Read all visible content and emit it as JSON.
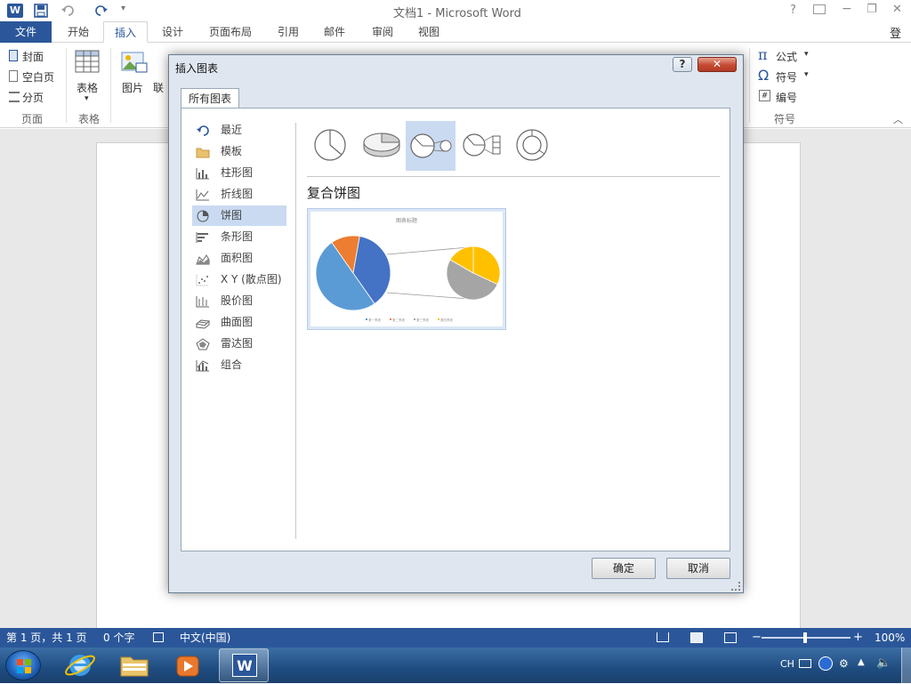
{
  "window": {
    "title": "文档1 - Microsoft Word",
    "help": "?",
    "minimize": "−",
    "restore": "❐",
    "close": "✕",
    "signin": "登录"
  },
  "ribbon_tabs": [
    {
      "label": "文件"
    },
    {
      "label": "开始"
    },
    {
      "label": "插入"
    },
    {
      "label": "设计"
    },
    {
      "label": "页面布局"
    },
    {
      "label": "引用"
    },
    {
      "label": "邮件"
    },
    {
      "label": "审阅"
    },
    {
      "label": "视图"
    }
  ],
  "ribbon": {
    "pages": {
      "cover": "封面",
      "blank": "空白页",
      "break": "分页",
      "group": "页面"
    },
    "table": {
      "label": "表格",
      "group": "表格"
    },
    "illustrations": {
      "picture": "图片",
      "online": "联"
    },
    "symbols": {
      "equation": "公式",
      "symbol": "符号",
      "number": "编号",
      "group": "符号",
      "pi": "π",
      "omega": "Ω",
      "hash": "#"
    }
  },
  "dialog": {
    "title": "插入图表",
    "help": "?",
    "close": "✕",
    "tab": "所有图表",
    "categories": [
      {
        "label": "最近",
        "icon": "recent-icon"
      },
      {
        "label": "模板",
        "icon": "folder-icon"
      },
      {
        "label": "柱形图",
        "icon": "column-chart-icon"
      },
      {
        "label": "折线图",
        "icon": "line-chart-icon"
      },
      {
        "label": "饼图",
        "icon": "pie-chart-icon"
      },
      {
        "label": "条形图",
        "icon": "bar-chart-icon"
      },
      {
        "label": "面积图",
        "icon": "area-chart-icon"
      },
      {
        "label": "X Y (散点图)",
        "icon": "scatter-chart-icon"
      },
      {
        "label": "股价图",
        "icon": "stock-chart-icon"
      },
      {
        "label": "曲面图",
        "icon": "surface-chart-icon"
      },
      {
        "label": "雷达图",
        "icon": "radar-chart-icon"
      },
      {
        "label": "组合",
        "icon": "combo-chart-icon"
      }
    ],
    "selected_category": "饼图",
    "subtypes": [
      "pie",
      "3d-pie",
      "pie-of-pie",
      "bar-of-pie",
      "doughnut"
    ],
    "selected_subtype": "pie-of-pie",
    "heading": "复合饼图",
    "preview_title": "图表标题",
    "preview_legend": [
      "第一季度",
      "第二季度",
      "第三季度",
      "第四季度"
    ],
    "ok": "确定",
    "cancel": "取消"
  },
  "colors": {
    "accent": "#2b579a",
    "blue": "#5b9bd5",
    "orange": "#ed7d31",
    "gray": "#a5a5a5",
    "yellow": "#ffc000",
    "darkblue": "#4472c4",
    "selection": "#c9daf1"
  },
  "status": {
    "page": "第 1 页，共 1 页",
    "words": "0 个字",
    "language": "中文(中国)",
    "zoom": "100%",
    "zoom_out": "−",
    "zoom_in": "+"
  },
  "taskbar": {
    "lang": "CH",
    "word_letter": "W"
  }
}
